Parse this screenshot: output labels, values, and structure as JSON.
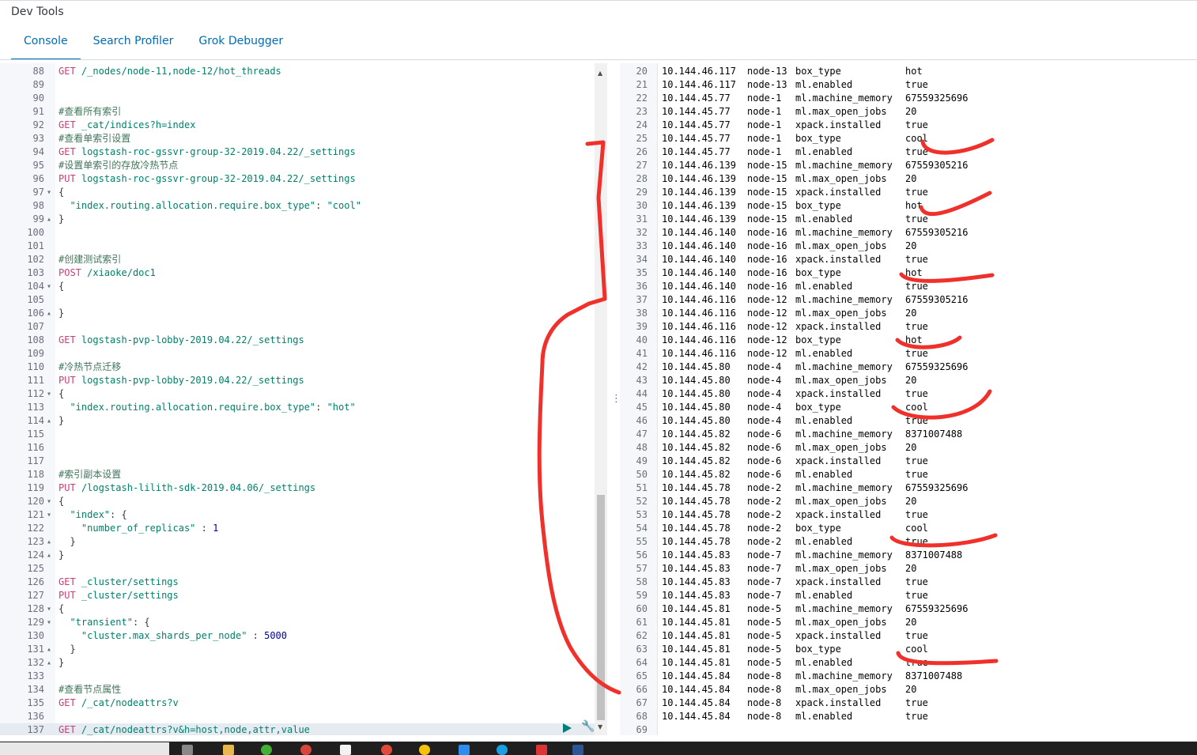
{
  "app": {
    "title": "Dev Tools"
  },
  "tabs": [
    {
      "label": "Console",
      "active": true
    },
    {
      "label": "Search Profiler",
      "active": false
    },
    {
      "label": "Grok Debugger",
      "active": false
    }
  ],
  "editor": {
    "lines": [
      {
        "n": "88",
        "fold": "",
        "parts": [
          [
            "m",
            "GET"
          ],
          [
            "t",
            " "
          ],
          [
            "p",
            "/_nodes/node-11,node-12/hot_threads"
          ]
        ]
      },
      {
        "n": "89",
        "fold": "",
        "parts": []
      },
      {
        "n": "90",
        "fold": "",
        "parts": []
      },
      {
        "n": "91",
        "fold": "",
        "parts": [
          [
            "c",
            "#查看所有索引"
          ]
        ]
      },
      {
        "n": "92",
        "fold": "",
        "parts": [
          [
            "m",
            "GET"
          ],
          [
            "t",
            " "
          ],
          [
            "p",
            "_cat/indices?h=index"
          ]
        ]
      },
      {
        "n": "93",
        "fold": "",
        "parts": [
          [
            "c",
            "#查看单索引设置"
          ]
        ]
      },
      {
        "n": "94",
        "fold": "",
        "parts": [
          [
            "m",
            "GET"
          ],
          [
            "t",
            " "
          ],
          [
            "p",
            "logstash-roc-gssvr-group-32-2019.04.22/_settings"
          ]
        ]
      },
      {
        "n": "95",
        "fold": "",
        "parts": [
          [
            "c",
            "#设置单索引的存放冷热节点"
          ]
        ]
      },
      {
        "n": "96",
        "fold": "",
        "parts": [
          [
            "m",
            "PUT"
          ],
          [
            "t",
            " "
          ],
          [
            "p",
            "logstash-roc-gssvr-group-32-2019.04.22/_settings"
          ]
        ]
      },
      {
        "n": "97",
        "fold": "▾",
        "parts": [
          [
            "t",
            "{"
          ]
        ]
      },
      {
        "n": "98",
        "fold": "",
        "parts": [
          [
            "t",
            "  "
          ],
          [
            "s",
            "\"index.routing.allocation.require.box_type\""
          ],
          [
            "t",
            ": "
          ],
          [
            "s",
            "\"cool\""
          ]
        ]
      },
      {
        "n": "99",
        "fold": "▴",
        "parts": [
          [
            "t",
            "}"
          ]
        ]
      },
      {
        "n": "100",
        "fold": "",
        "parts": []
      },
      {
        "n": "101",
        "fold": "",
        "parts": []
      },
      {
        "n": "102",
        "fold": "",
        "parts": [
          [
            "c",
            "#创建测试索引"
          ]
        ]
      },
      {
        "n": "103",
        "fold": "",
        "parts": [
          [
            "m",
            "POST"
          ],
          [
            "t",
            " "
          ],
          [
            "p",
            "/xiaoke/doc1"
          ]
        ]
      },
      {
        "n": "104",
        "fold": "▾",
        "parts": [
          [
            "t",
            "{"
          ]
        ]
      },
      {
        "n": "105",
        "fold": "",
        "parts": []
      },
      {
        "n": "106",
        "fold": "▴",
        "parts": [
          [
            "t",
            "}"
          ]
        ]
      },
      {
        "n": "107",
        "fold": "",
        "parts": []
      },
      {
        "n": "108",
        "fold": "",
        "parts": [
          [
            "m",
            "GET"
          ],
          [
            "t",
            " "
          ],
          [
            "p",
            "logstash-pvp-lobby-2019.04.22/_settings"
          ]
        ]
      },
      {
        "n": "109",
        "fold": "",
        "parts": []
      },
      {
        "n": "110",
        "fold": "",
        "parts": [
          [
            "c",
            "#冷热节点迁移"
          ]
        ]
      },
      {
        "n": "111",
        "fold": "",
        "parts": [
          [
            "m",
            "PUT"
          ],
          [
            "t",
            " "
          ],
          [
            "p",
            "logstash-pvp-lobby-2019.04.22/_settings"
          ]
        ]
      },
      {
        "n": "112",
        "fold": "▾",
        "parts": [
          [
            "t",
            "{"
          ]
        ]
      },
      {
        "n": "113",
        "fold": "",
        "parts": [
          [
            "t",
            "  "
          ],
          [
            "s",
            "\"index.routing.allocation.require.box_type\""
          ],
          [
            "t",
            ": "
          ],
          [
            "s",
            "\"hot\""
          ]
        ]
      },
      {
        "n": "114",
        "fold": "▴",
        "parts": [
          [
            "t",
            "}"
          ]
        ]
      },
      {
        "n": "115",
        "fold": "",
        "parts": []
      },
      {
        "n": "116",
        "fold": "",
        "parts": []
      },
      {
        "n": "117",
        "fold": "",
        "parts": []
      },
      {
        "n": "118",
        "fold": "",
        "parts": [
          [
            "c",
            "#索引副本设置"
          ]
        ]
      },
      {
        "n": "119",
        "fold": "",
        "parts": [
          [
            "m",
            "PUT"
          ],
          [
            "t",
            " "
          ],
          [
            "p",
            "/logstash-lilith-sdk-2019.04.06/_settings"
          ]
        ]
      },
      {
        "n": "120",
        "fold": "▾",
        "parts": [
          [
            "t",
            "{"
          ]
        ]
      },
      {
        "n": "121",
        "fold": "▾",
        "parts": [
          [
            "t",
            "  "
          ],
          [
            "s",
            "\"index\""
          ],
          [
            "t",
            ": {"
          ]
        ]
      },
      {
        "n": "122",
        "fold": "",
        "parts": [
          [
            "t",
            "    "
          ],
          [
            "s",
            "\"number_of_replicas\""
          ],
          [
            "t",
            " : "
          ],
          [
            "k",
            "1"
          ]
        ]
      },
      {
        "n": "123",
        "fold": "▴",
        "parts": [
          [
            "t",
            "  }"
          ]
        ]
      },
      {
        "n": "124",
        "fold": "▴",
        "parts": [
          [
            "t",
            "}"
          ]
        ]
      },
      {
        "n": "125",
        "fold": "",
        "parts": []
      },
      {
        "n": "126",
        "fold": "",
        "parts": [
          [
            "m",
            "GET"
          ],
          [
            "t",
            " "
          ],
          [
            "p",
            "_cluster/settings"
          ]
        ]
      },
      {
        "n": "127",
        "fold": "",
        "parts": [
          [
            "m",
            "PUT"
          ],
          [
            "t",
            " "
          ],
          [
            "p",
            "_cluster/settings"
          ]
        ]
      },
      {
        "n": "128",
        "fold": "▾",
        "parts": [
          [
            "t",
            "{"
          ]
        ]
      },
      {
        "n": "129",
        "fold": "▾",
        "parts": [
          [
            "t",
            "  "
          ],
          [
            "s",
            "\"transient\""
          ],
          [
            "t",
            ": {"
          ]
        ]
      },
      {
        "n": "130",
        "fold": "",
        "parts": [
          [
            "t",
            "    "
          ],
          [
            "s",
            "\"cluster.max_shards_per_node\""
          ],
          [
            "t",
            " : "
          ],
          [
            "k",
            "5000"
          ]
        ]
      },
      {
        "n": "131",
        "fold": "▴",
        "parts": [
          [
            "t",
            "  }"
          ]
        ]
      },
      {
        "n": "132",
        "fold": "▴",
        "parts": [
          [
            "t",
            "}"
          ]
        ]
      },
      {
        "n": "133",
        "fold": "",
        "parts": []
      },
      {
        "n": "134",
        "fold": "",
        "parts": [
          [
            "c",
            "#查看节点属性"
          ]
        ]
      },
      {
        "n": "135",
        "fold": "",
        "parts": [
          [
            "m",
            "GET"
          ],
          [
            "t",
            " "
          ],
          [
            "p",
            "/_cat/nodeattrs?v"
          ]
        ]
      },
      {
        "n": "136",
        "fold": "",
        "parts": []
      },
      {
        "n": "137",
        "fold": "",
        "active": true,
        "parts": [
          [
            "m",
            "GET"
          ],
          [
            "t",
            " "
          ],
          [
            "p",
            "/_cat/nodeattrs?v&h=host,node,attr,value"
          ]
        ]
      }
    ]
  },
  "output": {
    "rows": [
      {
        "n": "20",
        "host": "10.144.46.117",
        "node": "node-13",
        "attr": "box_type",
        "value": "hot"
      },
      {
        "n": "21",
        "host": "10.144.46.117",
        "node": "node-13",
        "attr": "ml.enabled",
        "value": "true"
      },
      {
        "n": "22",
        "host": "10.144.45.77",
        "node": "node-1",
        "attr": "ml.machine_memory",
        "value": "67559325696"
      },
      {
        "n": "23",
        "host": "10.144.45.77",
        "node": "node-1",
        "attr": "ml.max_open_jobs",
        "value": "20"
      },
      {
        "n": "24",
        "host": "10.144.45.77",
        "node": "node-1",
        "attr": "xpack.installed",
        "value": "true"
      },
      {
        "n": "25",
        "host": "10.144.45.77",
        "node": "node-1",
        "attr": "box_type",
        "value": "cool"
      },
      {
        "n": "26",
        "host": "10.144.45.77",
        "node": "node-1",
        "attr": "ml.enabled",
        "value": "true"
      },
      {
        "n": "27",
        "host": "10.144.46.139",
        "node": "node-15",
        "attr": "ml.machine_memory",
        "value": "67559305216"
      },
      {
        "n": "28",
        "host": "10.144.46.139",
        "node": "node-15",
        "attr": "ml.max_open_jobs",
        "value": "20"
      },
      {
        "n": "29",
        "host": "10.144.46.139",
        "node": "node-15",
        "attr": "xpack.installed",
        "value": "true"
      },
      {
        "n": "30",
        "host": "10.144.46.139",
        "node": "node-15",
        "attr": "box_type",
        "value": "hot"
      },
      {
        "n": "31",
        "host": "10.144.46.139",
        "node": "node-15",
        "attr": "ml.enabled",
        "value": "true"
      },
      {
        "n": "32",
        "host": "10.144.46.140",
        "node": "node-16",
        "attr": "ml.machine_memory",
        "value": "67559305216"
      },
      {
        "n": "33",
        "host": "10.144.46.140",
        "node": "node-16",
        "attr": "ml.max_open_jobs",
        "value": "20"
      },
      {
        "n": "34",
        "host": "10.144.46.140",
        "node": "node-16",
        "attr": "xpack.installed",
        "value": "true"
      },
      {
        "n": "35",
        "host": "10.144.46.140",
        "node": "node-16",
        "attr": "box_type",
        "value": "hot"
      },
      {
        "n": "36",
        "host": "10.144.46.140",
        "node": "node-16",
        "attr": "ml.enabled",
        "value": "true"
      },
      {
        "n": "37",
        "host": "10.144.46.116",
        "node": "node-12",
        "attr": "ml.machine_memory",
        "value": "67559305216"
      },
      {
        "n": "38",
        "host": "10.144.46.116",
        "node": "node-12",
        "attr": "ml.max_open_jobs",
        "value": "20"
      },
      {
        "n": "39",
        "host": "10.144.46.116",
        "node": "node-12",
        "attr": "xpack.installed",
        "value": "true"
      },
      {
        "n": "40",
        "host": "10.144.46.116",
        "node": "node-12",
        "attr": "box_type",
        "value": "hot"
      },
      {
        "n": "41",
        "host": "10.144.46.116",
        "node": "node-12",
        "attr": "ml.enabled",
        "value": "true"
      },
      {
        "n": "42",
        "host": "10.144.45.80",
        "node": "node-4",
        "attr": "ml.machine_memory",
        "value": "67559325696"
      },
      {
        "n": "43",
        "host": "10.144.45.80",
        "node": "node-4",
        "attr": "ml.max_open_jobs",
        "value": "20"
      },
      {
        "n": "44",
        "host": "10.144.45.80",
        "node": "node-4",
        "attr": "xpack.installed",
        "value": "true"
      },
      {
        "n": "45",
        "host": "10.144.45.80",
        "node": "node-4",
        "attr": "box_type",
        "value": "cool"
      },
      {
        "n": "46",
        "host": "10.144.45.80",
        "node": "node-4",
        "attr": "ml.enabled",
        "value": "true"
      },
      {
        "n": "47",
        "host": "10.144.45.82",
        "node": "node-6",
        "attr": "ml.machine_memory",
        "value": "8371007488"
      },
      {
        "n": "48",
        "host": "10.144.45.82",
        "node": "node-6",
        "attr": "ml.max_open_jobs",
        "value": "20"
      },
      {
        "n": "49",
        "host": "10.144.45.82",
        "node": "node-6",
        "attr": "xpack.installed",
        "value": "true"
      },
      {
        "n": "50",
        "host": "10.144.45.82",
        "node": "node-6",
        "attr": "ml.enabled",
        "value": "true"
      },
      {
        "n": "51",
        "host": "10.144.45.78",
        "node": "node-2",
        "attr": "ml.machine_memory",
        "value": "67559325696"
      },
      {
        "n": "52",
        "host": "10.144.45.78",
        "node": "node-2",
        "attr": "ml.max_open_jobs",
        "value": "20"
      },
      {
        "n": "53",
        "host": "10.144.45.78",
        "node": "node-2",
        "attr": "xpack.installed",
        "value": "true"
      },
      {
        "n": "54",
        "host": "10.144.45.78",
        "node": "node-2",
        "attr": "box_type",
        "value": "cool"
      },
      {
        "n": "55",
        "host": "10.144.45.78",
        "node": "node-2",
        "attr": "ml.enabled",
        "value": "true"
      },
      {
        "n": "56",
        "host": "10.144.45.83",
        "node": "node-7",
        "attr": "ml.machine_memory",
        "value": "8371007488"
      },
      {
        "n": "57",
        "host": "10.144.45.83",
        "node": "node-7",
        "attr": "ml.max_open_jobs",
        "value": "20"
      },
      {
        "n": "58",
        "host": "10.144.45.83",
        "node": "node-7",
        "attr": "xpack.installed",
        "value": "true"
      },
      {
        "n": "59",
        "host": "10.144.45.83",
        "node": "node-7",
        "attr": "ml.enabled",
        "value": "true"
      },
      {
        "n": "60",
        "host": "10.144.45.81",
        "node": "node-5",
        "attr": "ml.machine_memory",
        "value": "67559325696"
      },
      {
        "n": "61",
        "host": "10.144.45.81",
        "node": "node-5",
        "attr": "ml.max_open_jobs",
        "value": "20"
      },
      {
        "n": "62",
        "host": "10.144.45.81",
        "node": "node-5",
        "attr": "xpack.installed",
        "value": "true"
      },
      {
        "n": "63",
        "host": "10.144.45.81",
        "node": "node-5",
        "attr": "box_type",
        "value": "cool"
      },
      {
        "n": "64",
        "host": "10.144.45.81",
        "node": "node-5",
        "attr": "ml.enabled",
        "value": "true"
      },
      {
        "n": "65",
        "host": "10.144.45.84",
        "node": "node-8",
        "attr": "ml.machine_memory",
        "value": "8371007488"
      },
      {
        "n": "66",
        "host": "10.144.45.84",
        "node": "node-8",
        "attr": "ml.max_open_jobs",
        "value": "20"
      },
      {
        "n": "67",
        "host": "10.144.45.84",
        "node": "node-8",
        "attr": "xpack.installed",
        "value": "true"
      },
      {
        "n": "68",
        "host": "10.144.45.84",
        "node": "node-8",
        "attr": "ml.enabled",
        "value": "true"
      },
      {
        "n": "69",
        "host": "",
        "node": "",
        "attr": "",
        "value": ""
      }
    ]
  },
  "colors": {
    "accent": "#006bb4",
    "annotation_red": "#f0302a"
  },
  "icons": {
    "run": "play-icon",
    "settings": "wrench-icon",
    "resize": "vertical-dots-icon"
  }
}
